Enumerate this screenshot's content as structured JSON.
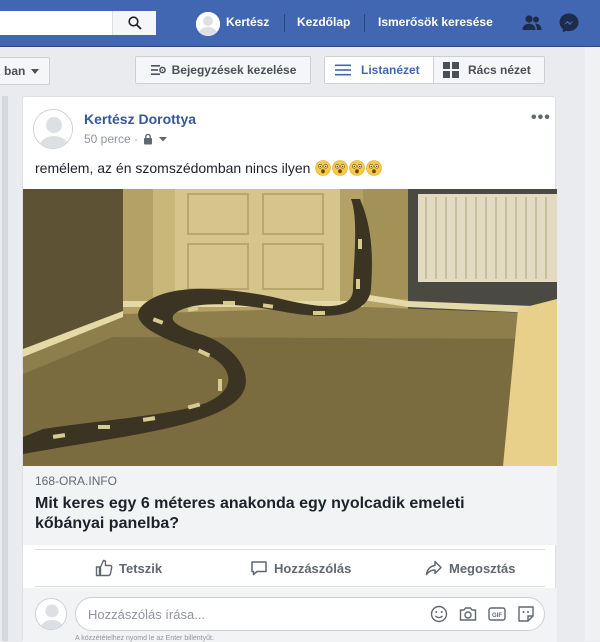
{
  "topbar": {
    "user_name": "Kertész",
    "home": "Kezdőlap",
    "find_friends": "Ismerősök keresése"
  },
  "toolbar": {
    "filter_label": "ban",
    "manage_posts": "Bejegyzések kezelése",
    "list_view": "Listanézet",
    "grid_view": "Rács nézet"
  },
  "post": {
    "author": "Kertész Dorottya",
    "time": "50 perce ·",
    "text": "remélem, az én szomszédomban nincs ilyen",
    "emoji_count": 4,
    "link": {
      "domain": "168-ORA.INFO",
      "title": "Mit keres egy 6 méteres anakonda egy nyolcadik emeleti kőbányai panelba?"
    },
    "actions": {
      "like": "Tetszik",
      "comment": "Hozzászólás",
      "share": "Megosztás"
    },
    "comment_placeholder": "Hozzászólás írása...",
    "comment_hint": "A közzétételhez nyomd le az Enter billentyűt."
  },
  "colors": {
    "brand": "#4267b2",
    "link": "#365899",
    "text": "#1d2129",
    "secondary": "#606770"
  }
}
